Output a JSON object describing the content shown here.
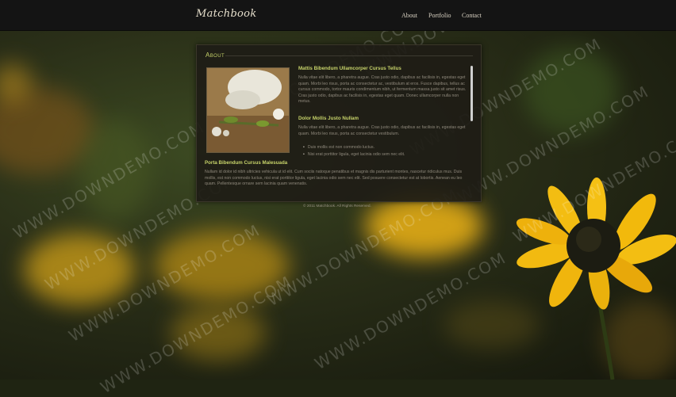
{
  "site": {
    "logo": "Matchbook"
  },
  "nav": {
    "items": [
      "About",
      "Portfolio",
      "Contact"
    ]
  },
  "panel": {
    "title": "About",
    "heading1": "Mattis Bibendum Ullamcorper Cursus Tellus",
    "para1": "Nulla vitae elit libero, a pharetra augue. Cras justo odio, dapibus ac facilisis in, egestas eget quam. Morbi leo risus, porta ac consectetur ac, vestibulum at eros. Fusce dapibus, tellus ac cursus commodo, tortor mauris condimentum nibh, ut fermentum massa justo sit amet risus. Cras justo odio, dapibus ac facilisis in, egestas eget quam. Donec ullamcorper nulla non metus.",
    "heading2": "Dolor Mollis Justo Nullam",
    "para2": "Nulla vitae elit libero, a pharetra augue. Cras justo odio, dapibus ac facilisis in, egestas eget quam. Morbi leo risus, porta ac consectetur vestibulum.",
    "bullets": [
      "Duis mollis est non commodo luctus.",
      "Nisi erat porttitor ligula, eget lacinia odio sem nec elit."
    ],
    "heading3": "Porta Bibendum Cursus Malesuada",
    "para3": "Nullam id dolor id nibh ultricies vehicula ut id elit. Cum sociis natoque penatibus et magnis dis parturient montes, nascetur ridiculus mus. Duis mollis, est non commodo luctus, nisi erat porttitor ligula, eget lacinia odio sem nec elit. Sed posuere consectetur est at lobortis. Aenean eu leo quam. Pellentesque ornare sem lacinia quam venenatis."
  },
  "footer": {
    "text": "© 2011 Matchbook. All Rights Reserved."
  },
  "watermark": {
    "text": "WWW.DOWNDEMO.COM"
  },
  "colors": {
    "accent": "#c7d36a",
    "topbar": "#141414",
    "petal": "#f2b90c"
  }
}
